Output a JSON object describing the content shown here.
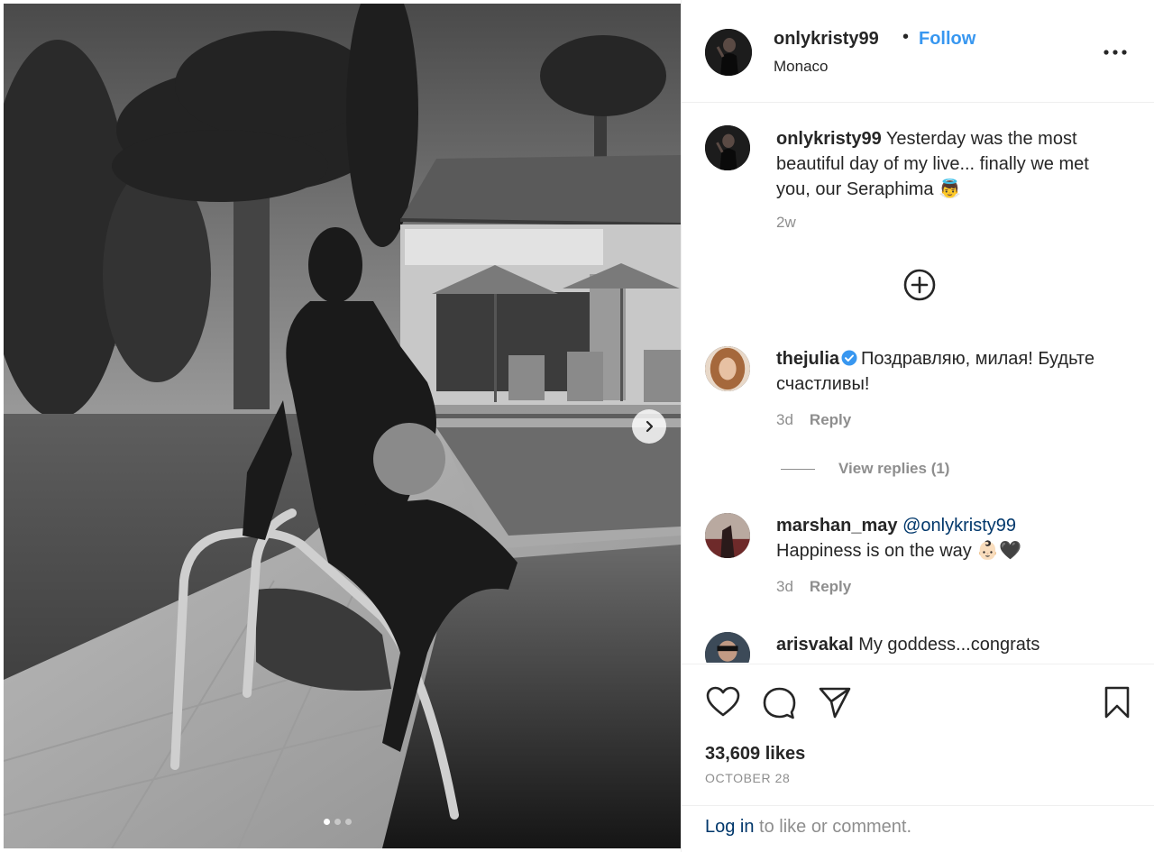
{
  "post": {
    "username": "onlykristy99",
    "separator": "•",
    "follow_label": "Follow",
    "location": "Monaco",
    "image": {
      "description_icon": "photo-icon",
      "total_slides": 3,
      "active_slide": 1
    }
  },
  "caption": {
    "username": "onlykristy99",
    "text": " Yesterday was the most beautiful day of my live... finally we met you, our Seraphima 👼",
    "age": "2w"
  },
  "comments": [
    {
      "username": "thejulia",
      "verified": true,
      "text": "Поздравляю, милая! Будьте счастливы!",
      "age": "3d",
      "reply_label": "Reply",
      "view_replies_label": "View replies (1)"
    },
    {
      "username": "marshan_may",
      "mention": "@onlykristy99",
      "text": "Happiness is on the way 👶🏻🖤",
      "age": "3d",
      "reply_label": "Reply"
    },
    {
      "username": "arisvakal",
      "text": " My goddess...congrats"
    }
  ],
  "actions": {
    "like_icon": "heart-icon",
    "comment_icon": "comment-icon",
    "share_icon": "send-icon",
    "save_icon": "bookmark-icon"
  },
  "stats": {
    "likes": "33,609 likes",
    "date": "OCTOBER 28"
  },
  "login": {
    "link_label": "Log in",
    "suffix": " to like or comment."
  },
  "colors": {
    "accent_blue": "#3897f0",
    "link_dark": "#00376b",
    "muted": "#8e8e8e",
    "text": "#262626",
    "divider": "#efefef"
  }
}
